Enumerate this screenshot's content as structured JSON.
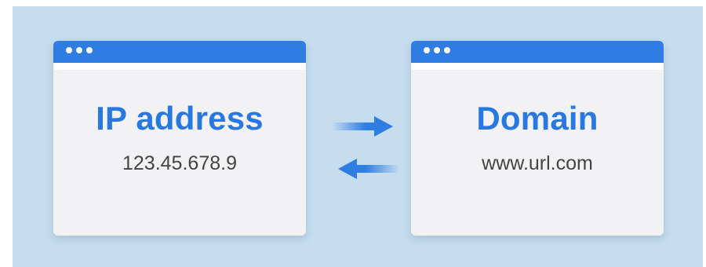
{
  "colors": {
    "background": "#c5ddee",
    "window_body": "#f2f2f4",
    "title_bar": "#2f7de3",
    "heading": "#2878e0",
    "value_text": "#444444",
    "arrow": "#2f7de3"
  },
  "left_window": {
    "heading": "IP address",
    "value": "123.45.678.9"
  },
  "right_window": {
    "heading": "Domain",
    "value": "www.url.com"
  },
  "icons": {
    "window_controls": "three-dots",
    "conversion": "bidirectional-arrows"
  }
}
